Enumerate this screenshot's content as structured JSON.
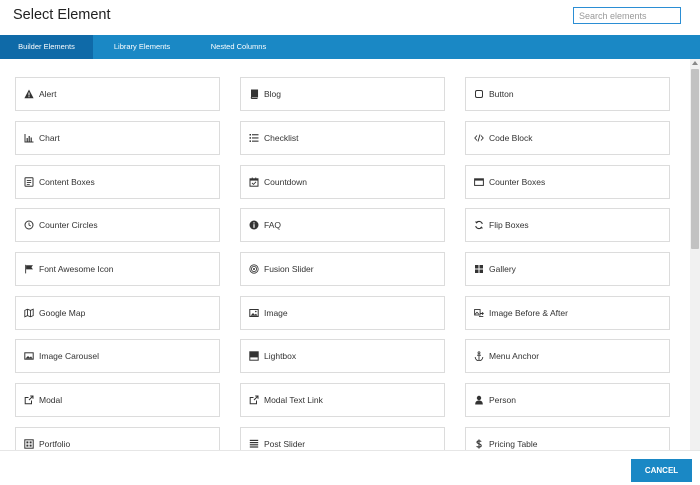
{
  "dialog": {
    "title": "Select Element"
  },
  "search": {
    "placeholder": "Search elements",
    "value": ""
  },
  "tabs": [
    {
      "label": "Builder Elements",
      "active": true
    },
    {
      "label": "Library Elements",
      "active": false
    },
    {
      "label": "Nested Columns",
      "active": false
    }
  ],
  "elements": [
    {
      "label": "Alert",
      "icon": "warning-icon"
    },
    {
      "label": "Blog",
      "icon": "book-icon"
    },
    {
      "label": "Button",
      "icon": "button-icon"
    },
    {
      "label": "Chart",
      "icon": "bar-chart-icon"
    },
    {
      "label": "Checklist",
      "icon": "list-icon"
    },
    {
      "label": "Code Block",
      "icon": "code-icon"
    },
    {
      "label": "Content Boxes",
      "icon": "content-boxes-icon"
    },
    {
      "label": "Countdown",
      "icon": "calendar-icon"
    },
    {
      "label": "Counter Boxes",
      "icon": "counter-box-icon"
    },
    {
      "label": "Counter Circles",
      "icon": "circle-clock-icon"
    },
    {
      "label": "FAQ",
      "icon": "info-icon"
    },
    {
      "label": "Flip Boxes",
      "icon": "flip-icon"
    },
    {
      "label": "Font Awesome Icon",
      "icon": "flag-icon"
    },
    {
      "label": "Fusion Slider",
      "icon": "target-icon"
    },
    {
      "label": "Gallery",
      "icon": "grid-icon"
    },
    {
      "label": "Google Map",
      "icon": "map-icon"
    },
    {
      "label": "Image",
      "icon": "image-icon"
    },
    {
      "label": "Image Before & After",
      "icon": "before-after-icon"
    },
    {
      "label": "Image Carousel",
      "icon": "carousel-icon"
    },
    {
      "label": "Lightbox",
      "icon": "lightbox-icon"
    },
    {
      "label": "Menu Anchor",
      "icon": "anchor-icon"
    },
    {
      "label": "Modal",
      "icon": "external-link-icon"
    },
    {
      "label": "Modal Text Link",
      "icon": "external-link-icon"
    },
    {
      "label": "Person",
      "icon": "person-icon"
    },
    {
      "label": "Portfolio",
      "icon": "portfolio-icon"
    },
    {
      "label": "Post Slider",
      "icon": "post-slider-icon"
    },
    {
      "label": "Pricing Table",
      "icon": "dollar-icon"
    }
  ],
  "footer": {
    "cancel_label": "CANCEL"
  },
  "colors": {
    "accent": "#1a88c5",
    "accent_dark": "#0f6aa8",
    "search_border": "#2b8ed4"
  }
}
